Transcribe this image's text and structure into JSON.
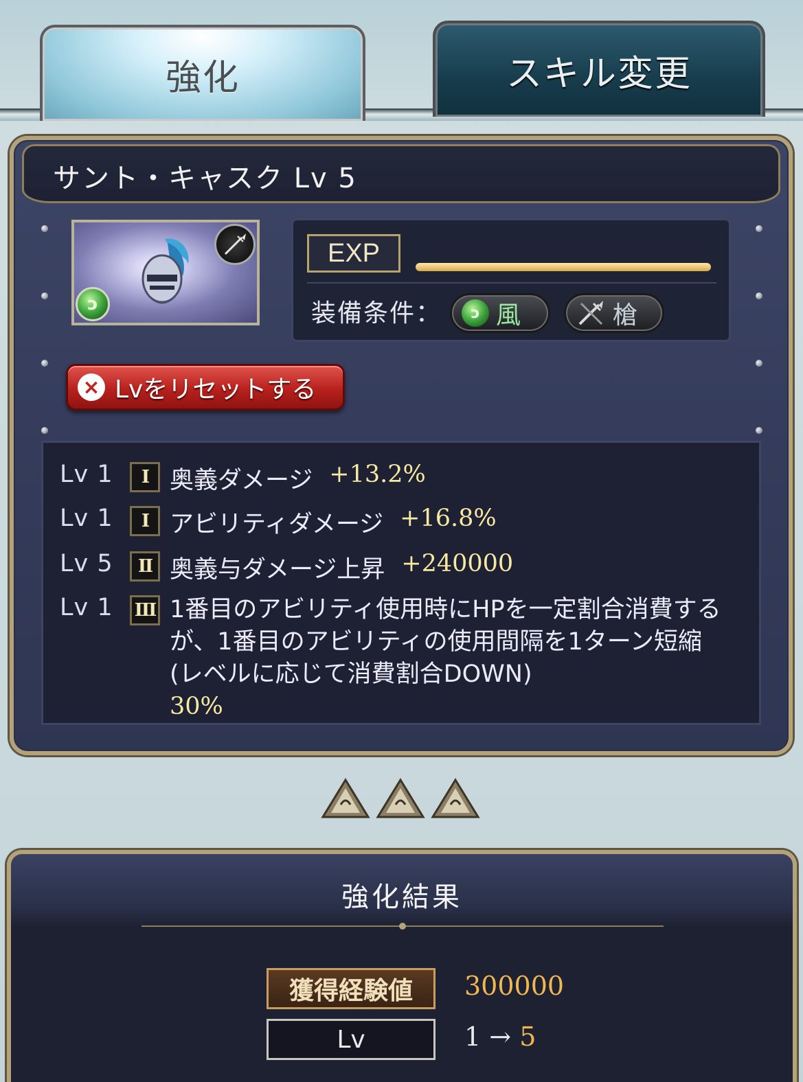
{
  "tabs": {
    "active_label": "強化",
    "inactive_label": "スキル変更"
  },
  "item": {
    "title": "サント・キャスク Lv 5",
    "exp_label": "EXP",
    "exp_progress": 1.0,
    "equip_label": "装備条件：",
    "element_label": "風",
    "weapon_label": "槍",
    "reset_button_label": "Lvをリセットする"
  },
  "skills": [
    {
      "lv": "Lv 1",
      "rank": "I",
      "name": "奥義ダメージ",
      "value": "+13.2%"
    },
    {
      "lv": "Lv 1",
      "rank": "I",
      "name": "アビリティダメージ",
      "value": "+16.8%"
    },
    {
      "lv": "Lv 5",
      "rank": "II",
      "name": "奥義与ダメージ上昇",
      "value": "+240000"
    },
    {
      "lv": "Lv 1",
      "rank": "III",
      "name": "1番目のアビリティ使用時にHPを一定割合消費するが、1番目のアビリティの使用間隔を1ターン短縮(レベルに応じて消費割合DOWN)",
      "value": "30%"
    }
  ],
  "result": {
    "title": "強化結果",
    "exp_label": "獲得経験値",
    "exp_value": "300000",
    "lv_label": "Lv",
    "lv_from": "1",
    "lv_arrow": "→",
    "lv_to": "5"
  },
  "colors": {
    "accent_gold": "#b3a27a",
    "value_yellow": "#f7e8a2",
    "reset_red": "#b8211d",
    "panel_navy": "#353c5b"
  }
}
